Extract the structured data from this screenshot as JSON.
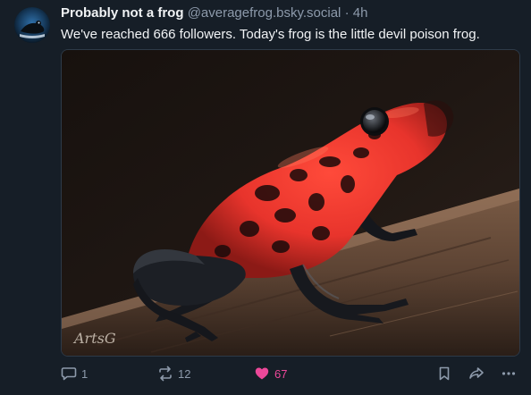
{
  "post": {
    "display_name": "Probably not a frog",
    "handle": "@averagefrog.bsky.social",
    "separator": "·",
    "time": "4h",
    "text": "We've reached 666 followers. Today's frog is the little devil poison frog.",
    "image": {
      "subject": "little devil poison frog",
      "watermark": "ArtsG"
    }
  },
  "actions": {
    "reply_count": "1",
    "repost_count": "12",
    "like_count": "67"
  },
  "icons": {
    "reply": "speech-bubble-icon",
    "repost": "repost-arrows-icon",
    "like": "heart-icon",
    "bookmark": "bookmark-icon",
    "share": "share-icon",
    "more": "ellipsis-icon"
  },
  "colors": {
    "background": "#161e27",
    "text": "#f1f3f5",
    "muted": "#8d9aab",
    "like": "#ec4899",
    "frog_red": "#e8342c"
  }
}
